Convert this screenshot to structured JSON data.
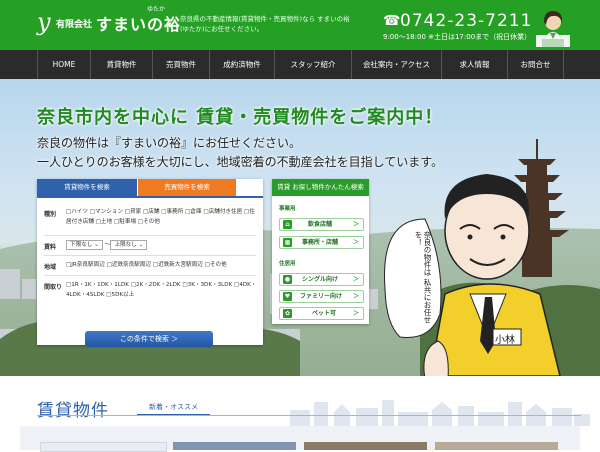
{
  "header": {
    "logo_mark": "y",
    "company_prefix": "有限会社",
    "company_name": "すまいの裕",
    "company_ruby": "ゆたか",
    "tagline": "奈良県の不動産情報(賃貸物件・売買物件)なら すまいの裕(ゆたか)にお任せください。",
    "phone": "0742-23-7211",
    "hours": "9:00～18:00 ※土日は17:00まで（祝日休業）"
  },
  "nav": [
    "HOME",
    "賃貸物件",
    "売買物件",
    "成約済物件",
    "スタッフ紹介",
    "会社案内・アクセス",
    "求人情報",
    "お問合せ"
  ],
  "hero": {
    "title": "奈良市内を中心に 賃貸・売買物件をご案内中！",
    "sub1": "奈良の物件は『すまいの裕』にお任せください。",
    "sub2": "一人ひとりのお客様を大切にし、地域密着の不動産会社を目指しています。",
    "character_name": "小林",
    "speech": "奈良の物件は 私共にお任せを！"
  },
  "search": {
    "tab_rent": "賃貸物件を検索",
    "tab_sale": "売買物件を検索",
    "type_label": "種別",
    "type_options": "□ハイツ □マンション □貸家 □店舗 □事務所 □倉庫 □店舗付き住居 □住居付き店舗 □土地 □駐車場 □その他",
    "rent_label": "賃料",
    "rent_min": "下限なし",
    "rent_max": "上限なし",
    "rent_sep": "～",
    "area_label": "地域",
    "area_options": "□JR奈良駅周辺 □近鉄奈良駅周辺 □近鉄新大宮駅周辺 □その他",
    "layout_label": "間取り",
    "layout_options": "□1R・1K・1DK・1LDK □2K・2DK・2LDK □3K・3DK・3LDK □4DK・4LDK・4SLDK □5DK以上",
    "button": "この条件で検索 ＞"
  },
  "quick": {
    "title": "賃貸 お探し物件かんたん検索",
    "cat_business": "事業用",
    "btn_restaurant": "飲食店舗",
    "btn_office": "事務所・店舗",
    "cat_residential": "住居用",
    "btn_single": "シングル向け",
    "btn_family": "ファミリー向け",
    "btn_pet": "ペット可",
    "chevron": "＞"
  },
  "section": {
    "title": "賃貸物件",
    "subtitle": "新着・オススメ"
  },
  "colors": {
    "brand_green": "#25a025",
    "nav_dark": "#2b2b2b",
    "rent_blue": "#3061ad",
    "sale_orange": "#f07a22"
  }
}
